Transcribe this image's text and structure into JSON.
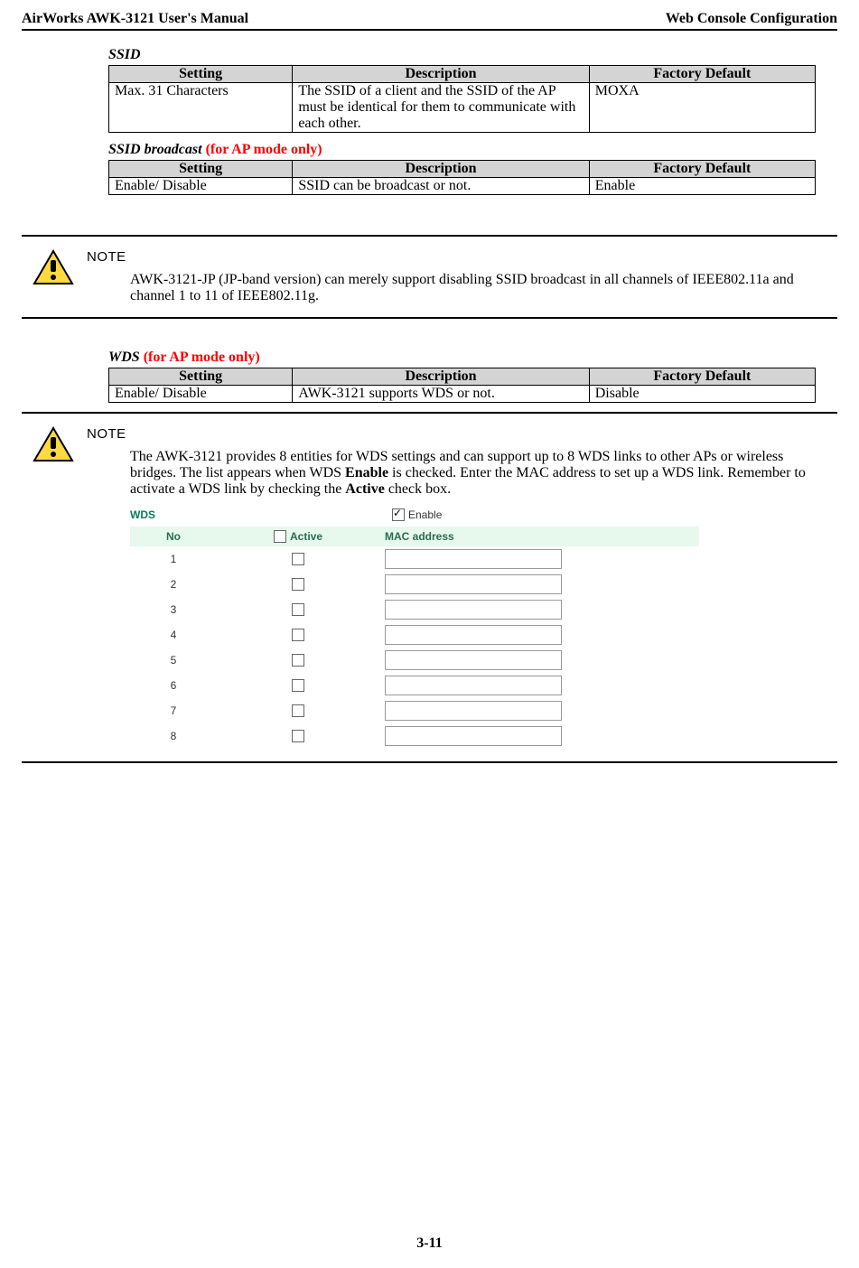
{
  "header": {
    "left": "AirWorks AWK-3121 User's Manual",
    "right": "Web Console Configuration"
  },
  "ssid": {
    "title": "SSID",
    "th": {
      "setting": "Setting",
      "description": "Description",
      "default": "Factory Default"
    },
    "row": {
      "setting": "Max. 31 Characters",
      "description": "The SSID of a client and the SSID of the AP must be identical for them to communicate with each other.",
      "default": "MOXA"
    }
  },
  "ssid_bc": {
    "title_main": "SSID broadcast ",
    "title_note": "(for AP mode only)",
    "th": {
      "setting": "Setting",
      "description": "Description",
      "default": "Factory Default"
    },
    "row": {
      "setting": "Enable/ Disable",
      "description": "SSID can be broadcast or not.",
      "default": "Enable"
    }
  },
  "note1": {
    "label": "NOTE",
    "text": "AWK-3121-JP (JP-band version) can merely support disabling SSID broadcast in all channels of IEEE802.11a and channel 1 to 11 of IEEE802.11g."
  },
  "wds": {
    "title_main": "WDS ",
    "title_note": "(for AP mode only)",
    "th": {
      "setting": "Setting",
      "description": "Description",
      "default": "Factory Default"
    },
    "row": {
      "setting": "Enable/ Disable",
      "description": "AWK-3121 supports WDS or not.",
      "default": "Disable"
    }
  },
  "note2": {
    "label": "NOTE",
    "text_pre": "The AWK-3121 provides 8 entities for WDS settings and can support up to 8 WDS links to other APs or wireless bridges. The list appears when WDS ",
    "bold1": "Enable",
    "text_mid": " is checked. Enter the MAC address to set up a WDS link. Remember to activate a WDS link by checking the ",
    "bold2": "Active",
    "text_end": " check box."
  },
  "wds_panel": {
    "label": "WDS",
    "enable": "Enable",
    "header": {
      "no": "No",
      "active": "Active",
      "mac": "MAC address"
    },
    "rows": [
      {
        "no": "1"
      },
      {
        "no": "2"
      },
      {
        "no": "3"
      },
      {
        "no": "4"
      },
      {
        "no": "5"
      },
      {
        "no": "6"
      },
      {
        "no": "7"
      },
      {
        "no": "8"
      }
    ]
  },
  "page_num": "3-11"
}
